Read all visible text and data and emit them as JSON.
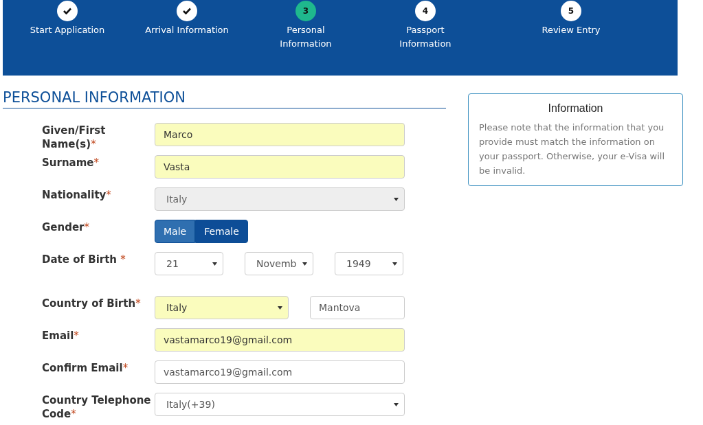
{
  "steps": [
    {
      "label": "Start Application",
      "completed": true,
      "current": false
    },
    {
      "label": "Arrival Information",
      "completed": true,
      "current": false
    },
    {
      "marker": "3",
      "label": "Personal Information",
      "completed": false,
      "current": true
    },
    {
      "marker": "4",
      "label": "Passport Information",
      "completed": false,
      "current": false
    },
    {
      "marker": "5",
      "label": "Review Entry",
      "completed": false,
      "current": false
    }
  ],
  "section_title": "PERSONAL INFORMATION",
  "required_mark": "*",
  "form_rows": [
    {
      "kind": "text",
      "label": "Given/First Name(s)",
      "fields": [
        {
          "value": "Marco",
          "highlighted": true,
          "disabled": false
        }
      ]
    },
    {
      "kind": "text",
      "label": "Surname",
      "fields": [
        {
          "value": "Vasta",
          "highlighted": true,
          "disabled": false
        }
      ]
    },
    {
      "kind": "select",
      "label": "Nationality",
      "fields": [
        {
          "value": "Italy",
          "disabled": true
        }
      ]
    },
    {
      "kind": "choice",
      "label": "Gender",
      "options": [
        {
          "label": "Male",
          "selected": true
        },
        {
          "label": "Female",
          "selected": false
        }
      ]
    },
    {
      "kind": "date",
      "label": "Date of Birth ",
      "fields": [
        {
          "value": "21",
          "highlighted": false,
          "disabled": false
        },
        {
          "value": "Novemb",
          "highlighted": false,
          "disabled": false
        },
        {
          "value": "1949",
          "highlighted": false,
          "disabled": false
        }
      ]
    },
    {
      "kind": "place",
      "label": "Country of Birth",
      "fields": [
        {
          "value": "Italy",
          "highlighted": true,
          "disabled": false
        },
        {
          "value": "Mantova",
          "highlighted": false,
          "disabled": false
        }
      ]
    },
    {
      "kind": "text",
      "label": "Email",
      "fields": [
        {
          "value": "vastamarco19@gmail.com",
          "highlighted": true,
          "disabled": false
        }
      ]
    },
    {
      "kind": "text",
      "label": "Confirm Email",
      "fields": [
        {
          "value": "vastamarco19@gmail.com",
          "highlighted": false,
          "disabled": false
        }
      ]
    },
    {
      "kind": "select",
      "label": "Country Telephone Code",
      "fields": [
        {
          "value": "Italy(+39)",
          "highlighted": false,
          "disabled": false
        }
      ]
    }
  ],
  "info_box": {
    "title": "Information",
    "text": "Please note that the information that you provide must match the information on your passport. Otherwise, your e-Visa will be invalid."
  }
}
